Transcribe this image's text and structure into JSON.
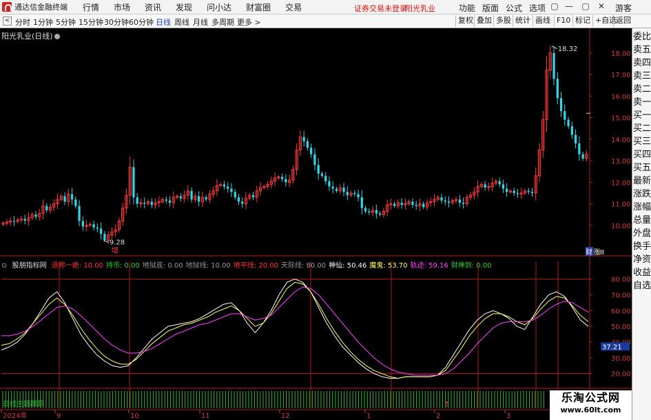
{
  "menubar": {
    "app_name": "通达信金融终端",
    "menus": [
      "行情",
      "市场",
      "资讯",
      "发现",
      "问小达",
      "财富圈",
      "交易"
    ],
    "warning": "证券交易未登录",
    "stock": "阳光乳业",
    "right_menus": [
      "功能",
      "版面",
      "公式",
      "选项"
    ],
    "win_buttons": [
      "▢",
      "—",
      "▢",
      "✕"
    ],
    "guest": "游客"
  },
  "toolbar": {
    "back": "<",
    "periods": [
      "分时",
      "1分钟",
      "5分钟",
      "15分钟",
      "30分钟",
      "60分钟",
      "日线",
      "周线",
      "月线",
      "多周期",
      "更多 >"
    ],
    "active_period": "日线",
    "right_buttons": [
      "复权",
      "叠加",
      "多股",
      "统计",
      "画线",
      "F10",
      "标记",
      "+自选",
      "返回"
    ]
  },
  "sidebar": [
    "委比",
    "卖五",
    "卖四",
    "卖三",
    "卖二",
    "卖一",
    "买一",
    "买二",
    "买三",
    "买四",
    "买五",
    "最新",
    "涨跌",
    "涨幅",
    "总量",
    "外盘",
    "换手",
    "净资",
    "收益",
    "自选"
  ],
  "main_chart": {
    "title": "阳光乳业(日线)",
    "price_ticks": [
      "18.00",
      "17.00",
      "16.00",
      "15.00",
      "14.00",
      "13.00",
      "12.00",
      "11.00",
      "10.00"
    ],
    "high_label": "18.32",
    "low_label": "9.28",
    "zeng_label": "增",
    "finance_label": "财",
    "zhang_label": "涨"
  },
  "indicator": {
    "name": "股朋指标网",
    "params": [
      {
        "label": "退称一绝:",
        "value": "10.00",
        "color": "#ff3333"
      },
      {
        "label": "持币:",
        "value": "0.00",
        "color": "#33cc33"
      },
      {
        "label": "地狱底:",
        "value": "0.00",
        "color": "#9a9a9a"
      },
      {
        "label": "地狱线:",
        "value": "10.00",
        "color": "#9a9a9a"
      },
      {
        "label": "地平线:",
        "value": "20.00",
        "color": "#ff3333"
      },
      {
        "label": "天际线:",
        "value": "80.00",
        "color": "#9a9a9a"
      },
      {
        "label": "神仙:",
        "value": "50.46",
        "color": "#ffffff"
      },
      {
        "label": "魔鬼:",
        "value": "53.70",
        "color": "#ffff55"
      },
      {
        "label": "轨迹:",
        "value": "59.16",
        "color": "#ff44ff"
      },
      {
        "label": "财神到:",
        "value": "0.00",
        "color": "#33cc33"
      }
    ],
    "ticks": [
      "80.00",
      "70.00",
      "60.00",
      "50.00",
      "40.00",
      "30.00",
      "20.00"
    ],
    "current_value": "37.21",
    "strip_label": "日线主题跟踪"
  },
  "date_axis": [
    "2024年",
    "9",
    "10",
    "11",
    "12",
    "1",
    "2",
    "3"
  ],
  "watermark": {
    "line1": "乐淘公式网",
    "line2": "www.60lt.com"
  },
  "chart_data": [
    {
      "type": "candlestick",
      "title": "阳光乳业(日线)",
      "ylim": [
        9.0,
        18.6
      ],
      "y_ticks": [
        10,
        11,
        12,
        13,
        14,
        15,
        16,
        17,
        18
      ],
      "x_ticks": [
        "2024年",
        "9",
        "10",
        "11",
        "12",
        "1",
        "2",
        "3"
      ],
      "closes": [
        10.1,
        10.15,
        10.2,
        10.18,
        10.25,
        10.3,
        10.22,
        10.35,
        10.5,
        10.4,
        10.55,
        10.9,
        10.7,
        10.85,
        11.0,
        11.2,
        11.35,
        11.1,
        11.45,
        11.2,
        10.9,
        10.2,
        9.95,
        10.0,
        10.05,
        9.9,
        9.85,
        9.6,
        9.3,
        9.55,
        9.7,
        9.8,
        10.2,
        10.8,
        11.4,
        12.7,
        11.3,
        11.0,
        11.05,
        11.0,
        11.1,
        10.95,
        11.05,
        11.1,
        11.2,
        11.15,
        11.05,
        11.3,
        11.35,
        11.25,
        11.4,
        11.6,
        11.2,
        11.35,
        11.1,
        11.3,
        11.2,
        11.45,
        11.6,
        11.85,
        11.9,
        11.8,
        11.7,
        11.55,
        11.3,
        11.1,
        11.0,
        11.25,
        11.4,
        11.3,
        11.6,
        11.75,
        11.8,
        11.9,
        12.05,
        12.2,
        12.25,
        12.15,
        12.0,
        12.1,
        12.6,
        13.5,
        14.1,
        13.9,
        13.6,
        13.3,
        12.8,
        12.4,
        12.3,
        12.05,
        11.8,
        11.7,
        11.6,
        11.75,
        11.55,
        11.4,
        11.5,
        11.45,
        11.3,
        10.8,
        10.65,
        10.6,
        10.7,
        10.55,
        10.5,
        10.65,
        10.95,
        11.0,
        10.9,
        11.05,
        10.95,
        11.0,
        11.1,
        10.95,
        10.9,
        11.0,
        10.85,
        11.05,
        11.1,
        11.2,
        11.3,
        11.15,
        11.1,
        11.05,
        11.15,
        11.2,
        11.05,
        11.0,
        11.3,
        11.4,
        11.55,
        11.8,
        11.9,
        11.75,
        11.8,
        11.95,
        12.05,
        11.9,
        11.7,
        11.55,
        11.6,
        11.5,
        11.45,
        11.5,
        11.6,
        11.55,
        11.5,
        12.3,
        13.5,
        14.9,
        17.2,
        18.0,
        16.8,
        15.9,
        15.3,
        14.9,
        14.6,
        14.2,
        13.8,
        13.3,
        13.1,
        13.3
      ],
      "high": 18.32,
      "low": 9.28
    },
    {
      "type": "line",
      "title": "股朋指标网",
      "ylim": [
        12,
        86
      ],
      "y_ticks": [
        20,
        30,
        40,
        50,
        60,
        70,
        80
      ],
      "series": [
        {
          "name": "神仙",
          "color": "#ffffff",
          "values": [
            35,
            37,
            40,
            45,
            52,
            60,
            68,
            72,
            65,
            55,
            45,
            38,
            32,
            28,
            25,
            24,
            25,
            30,
            36,
            42,
            46,
            50,
            51,
            52,
            53,
            55,
            58,
            61,
            64,
            65,
            60,
            52,
            46,
            52,
            60,
            70,
            78,
            80,
            78,
            72,
            62,
            52,
            44,
            37,
            32,
            27,
            23,
            20,
            18,
            17,
            17,
            18,
            18,
            18,
            18,
            19,
            24,
            32,
            40,
            48,
            54,
            58,
            60,
            58,
            55,
            50,
            48,
            56,
            64,
            70,
            72,
            69,
            62,
            54,
            50
          ]
        },
        {
          "name": "魔鬼",
          "color": "#ffff55",
          "values": [
            38,
            39,
            42,
            46,
            52,
            58,
            64,
            68,
            64,
            57,
            49,
            42,
            36,
            31,
            28,
            26,
            26,
            29,
            34,
            39,
            43,
            47,
            49,
            51,
            52,
            54,
            56,
            59,
            61,
            63,
            60,
            55,
            50,
            52,
            58,
            66,
            74,
            78,
            77,
            72,
            64,
            55,
            47,
            40,
            34,
            29,
            25,
            22,
            20,
            18,
            17,
            18,
            18,
            18,
            18,
            19,
            22,
            29,
            36,
            44,
            50,
            55,
            58,
            58,
            56,
            53,
            51,
            55,
            61,
            66,
            69,
            68,
            63,
            57,
            53
          ]
        },
        {
          "name": "轨迹",
          "color": "#ff44ff",
          "values": [
            44,
            44,
            45,
            47,
            50,
            54,
            58,
            62,
            63,
            61,
            57,
            52,
            47,
            42,
            38,
            35,
            33,
            33,
            34,
            36,
            39,
            42,
            45,
            47,
            49,
            51,
            52,
            54,
            56,
            58,
            58,
            56,
            54,
            55,
            57,
            62,
            67,
            72,
            75,
            74,
            70,
            64,
            58,
            52,
            46,
            40,
            35,
            30,
            26,
            23,
            21,
            20,
            19,
            19,
            19,
            19,
            20,
            23,
            28,
            33,
            39,
            44,
            49,
            52,
            53,
            53,
            53,
            54,
            57,
            61,
            64,
            66,
            65,
            62,
            59
          ]
        }
      ],
      "hlines": [
        80,
        20
      ],
      "current_value": 37.21
    }
  ]
}
